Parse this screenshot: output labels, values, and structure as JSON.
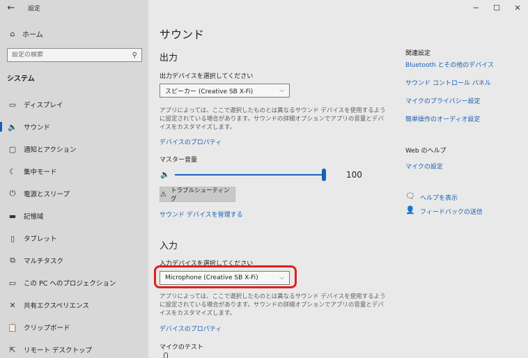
{
  "titlebar": {
    "app_title": "設定",
    "back_icon": "arrow-left-icon"
  },
  "window_controls": {
    "minimize": "─",
    "maximize": "☐",
    "close": "✕"
  },
  "sidebar": {
    "home_label": "ホーム",
    "search_placeholder": "設定の検索",
    "section_label": "システム",
    "items": [
      {
        "label": "ディスプレイ",
        "icon": "monitor-icon",
        "glyph": "▭"
      },
      {
        "label": "サウンド",
        "icon": "speaker-icon",
        "glyph": "🔈"
      },
      {
        "label": "通知とアクション",
        "icon": "notification-icon",
        "glyph": "▢"
      },
      {
        "label": "集中モード",
        "icon": "moon-icon",
        "glyph": "☾"
      },
      {
        "label": "電源とスリープ",
        "icon": "power-icon",
        "glyph": "⏻"
      },
      {
        "label": "記憶域",
        "icon": "storage-icon",
        "glyph": "▬"
      },
      {
        "label": "タブレット",
        "icon": "tablet-icon",
        "glyph": "▯"
      },
      {
        "label": "マルチタスク",
        "icon": "multitask-icon",
        "glyph": "⧉"
      },
      {
        "label": "この PC へのプロジェクション",
        "icon": "projection-icon",
        "glyph": "▭"
      },
      {
        "label": "共有エクスペリエンス",
        "icon": "shared-icon",
        "glyph": "✕"
      },
      {
        "label": "クリップボード",
        "icon": "clipboard-icon",
        "glyph": "📋"
      },
      {
        "label": "リモート デスクトップ",
        "icon": "remote-desktop-icon",
        "glyph": "⇱"
      }
    ]
  },
  "main": {
    "title": "サウンド",
    "output": {
      "heading": "出力",
      "select_label": "出力デバイスを選択してください",
      "device": "スピーカー (Creative SB X-Fi)",
      "description": "アプリによっては、ここで選択したものとは異なるサウンド デバイスを使用するように設定されている場合があります。サウンドの詳細オプションでアプリの音量とデバイスをカスタマイズします。",
      "properties_link": "デバイスのプロパティ",
      "volume_label": "マスター音量",
      "volume": 100,
      "troubleshoot_label": "トラブルシューティング",
      "manage_link": "サウンド デバイスを管理する"
    },
    "input": {
      "heading": "入力",
      "select_label": "入力デバイスを選択してください",
      "device": "Microphone (Creative SB X-Fi)",
      "description": "アプリによっては、ここで選択したものとは異なるサウンド デバイスを使用するように設定されている場合があります。サウンドの詳細オプションでアプリの音量とデバイスをカスタマイズします。",
      "properties_link": "デバイスのプロパティ",
      "test_label": "マイクのテスト"
    }
  },
  "right": {
    "related_heading": "関連設定",
    "related_links": [
      "Bluetooth とその他のデバイス",
      "サウンド コントロール パネル",
      "マイクのプライバシー設定",
      "簡単操作のオーディオ設定"
    ],
    "web_heading": "Web のヘルプ",
    "web_link": "マイクの設定",
    "help_link": "ヘルプを表示",
    "feedback_link": "フィードバックの送信"
  },
  "colors": {
    "accent": "#1a5fb4",
    "highlight": "#e0201a"
  }
}
